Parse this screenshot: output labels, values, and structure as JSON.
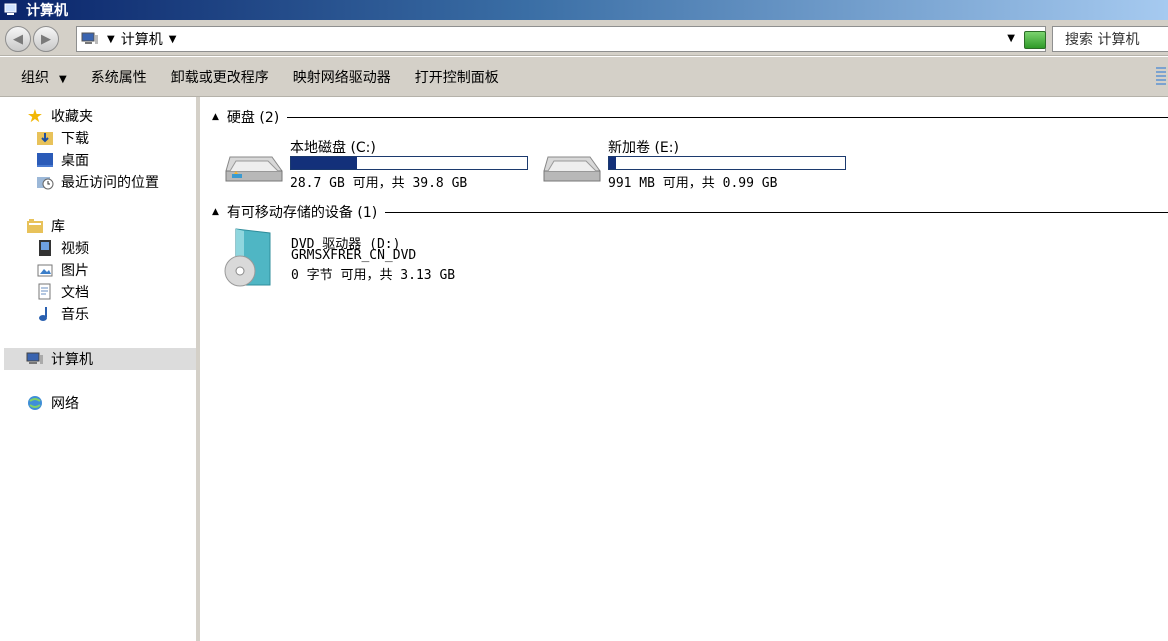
{
  "window": {
    "title": "计算机"
  },
  "address": {
    "crumb": "计算机"
  },
  "search": {
    "placeholder": "搜索 计算机"
  },
  "toolbar": {
    "organize": "组织",
    "system_properties": "系统属性",
    "uninstall": "卸载或更改程序",
    "map_drive": "映射网络驱动器",
    "control_panel": "打开控制面板"
  },
  "nav": {
    "favorites": "收藏夹",
    "downloads": "下载",
    "desktop": "桌面",
    "recent": "最近访问的位置",
    "libraries": "库",
    "videos": "视频",
    "pictures": "图片",
    "documents": "文档",
    "music": "音乐",
    "computer": "计算机",
    "network": "网络"
  },
  "groups": {
    "hard_disks": "硬盘 (2)",
    "removable": "有可移动存储的设备 (1)"
  },
  "drives": [
    {
      "name": "本地磁盘 (C:)",
      "free": "28.7 GB 可用，共 39.8 GB",
      "used_fraction": 0.28
    },
    {
      "name": "新加卷 (E:)",
      "free": "991 MB 可用，共 0.99 GB",
      "used_fraction": 0.03
    }
  ],
  "dvd": {
    "name": "DVD 驱动器 (D:)",
    "label": "GRMSXFRER_CN_DVD",
    "free": "0 字节 可用，共 3.13 GB"
  },
  "colors": {
    "bar_fill": "#13307a",
    "chrome": "#d4d0c8",
    "title_start": "#0a246a"
  }
}
